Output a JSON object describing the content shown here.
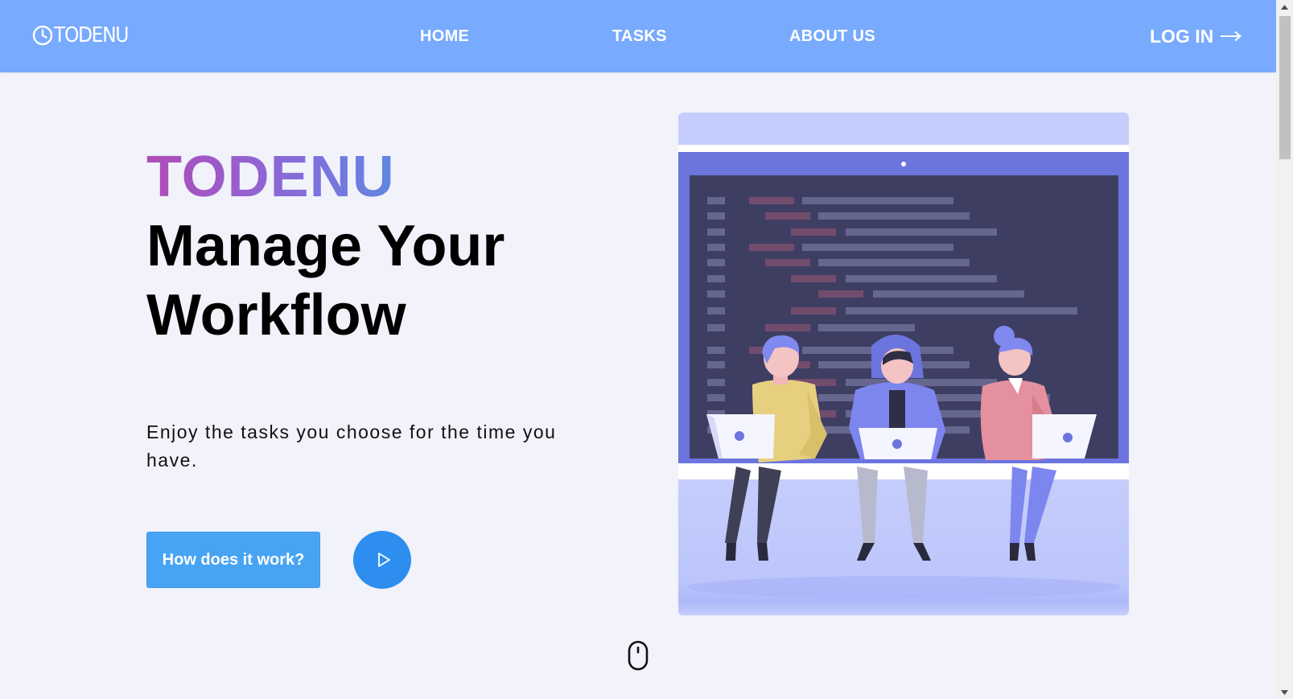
{
  "nav": {
    "logo_text": "TODENU",
    "links": [
      "HOME",
      "TASKS",
      "ABOUT US"
    ],
    "login_label": "LOG IN"
  },
  "hero": {
    "brand": "TODENU",
    "headline": "Manage Your Workflow",
    "tagline": "Enjoy the tasks you choose for the time you have.",
    "cta_label": "How does it work?"
  },
  "colors": {
    "navbar": "#78aafd",
    "background": "#f1f2fa",
    "cta": "#47a4f4",
    "play": "#2d8ef0",
    "brand_gradient": [
      "#b04bb7",
      "#8e66d6",
      "#5f86e3"
    ]
  },
  "icons": [
    "clock-icon",
    "arrow-right-icon",
    "play-icon",
    "mouse-scroll-icon"
  ]
}
